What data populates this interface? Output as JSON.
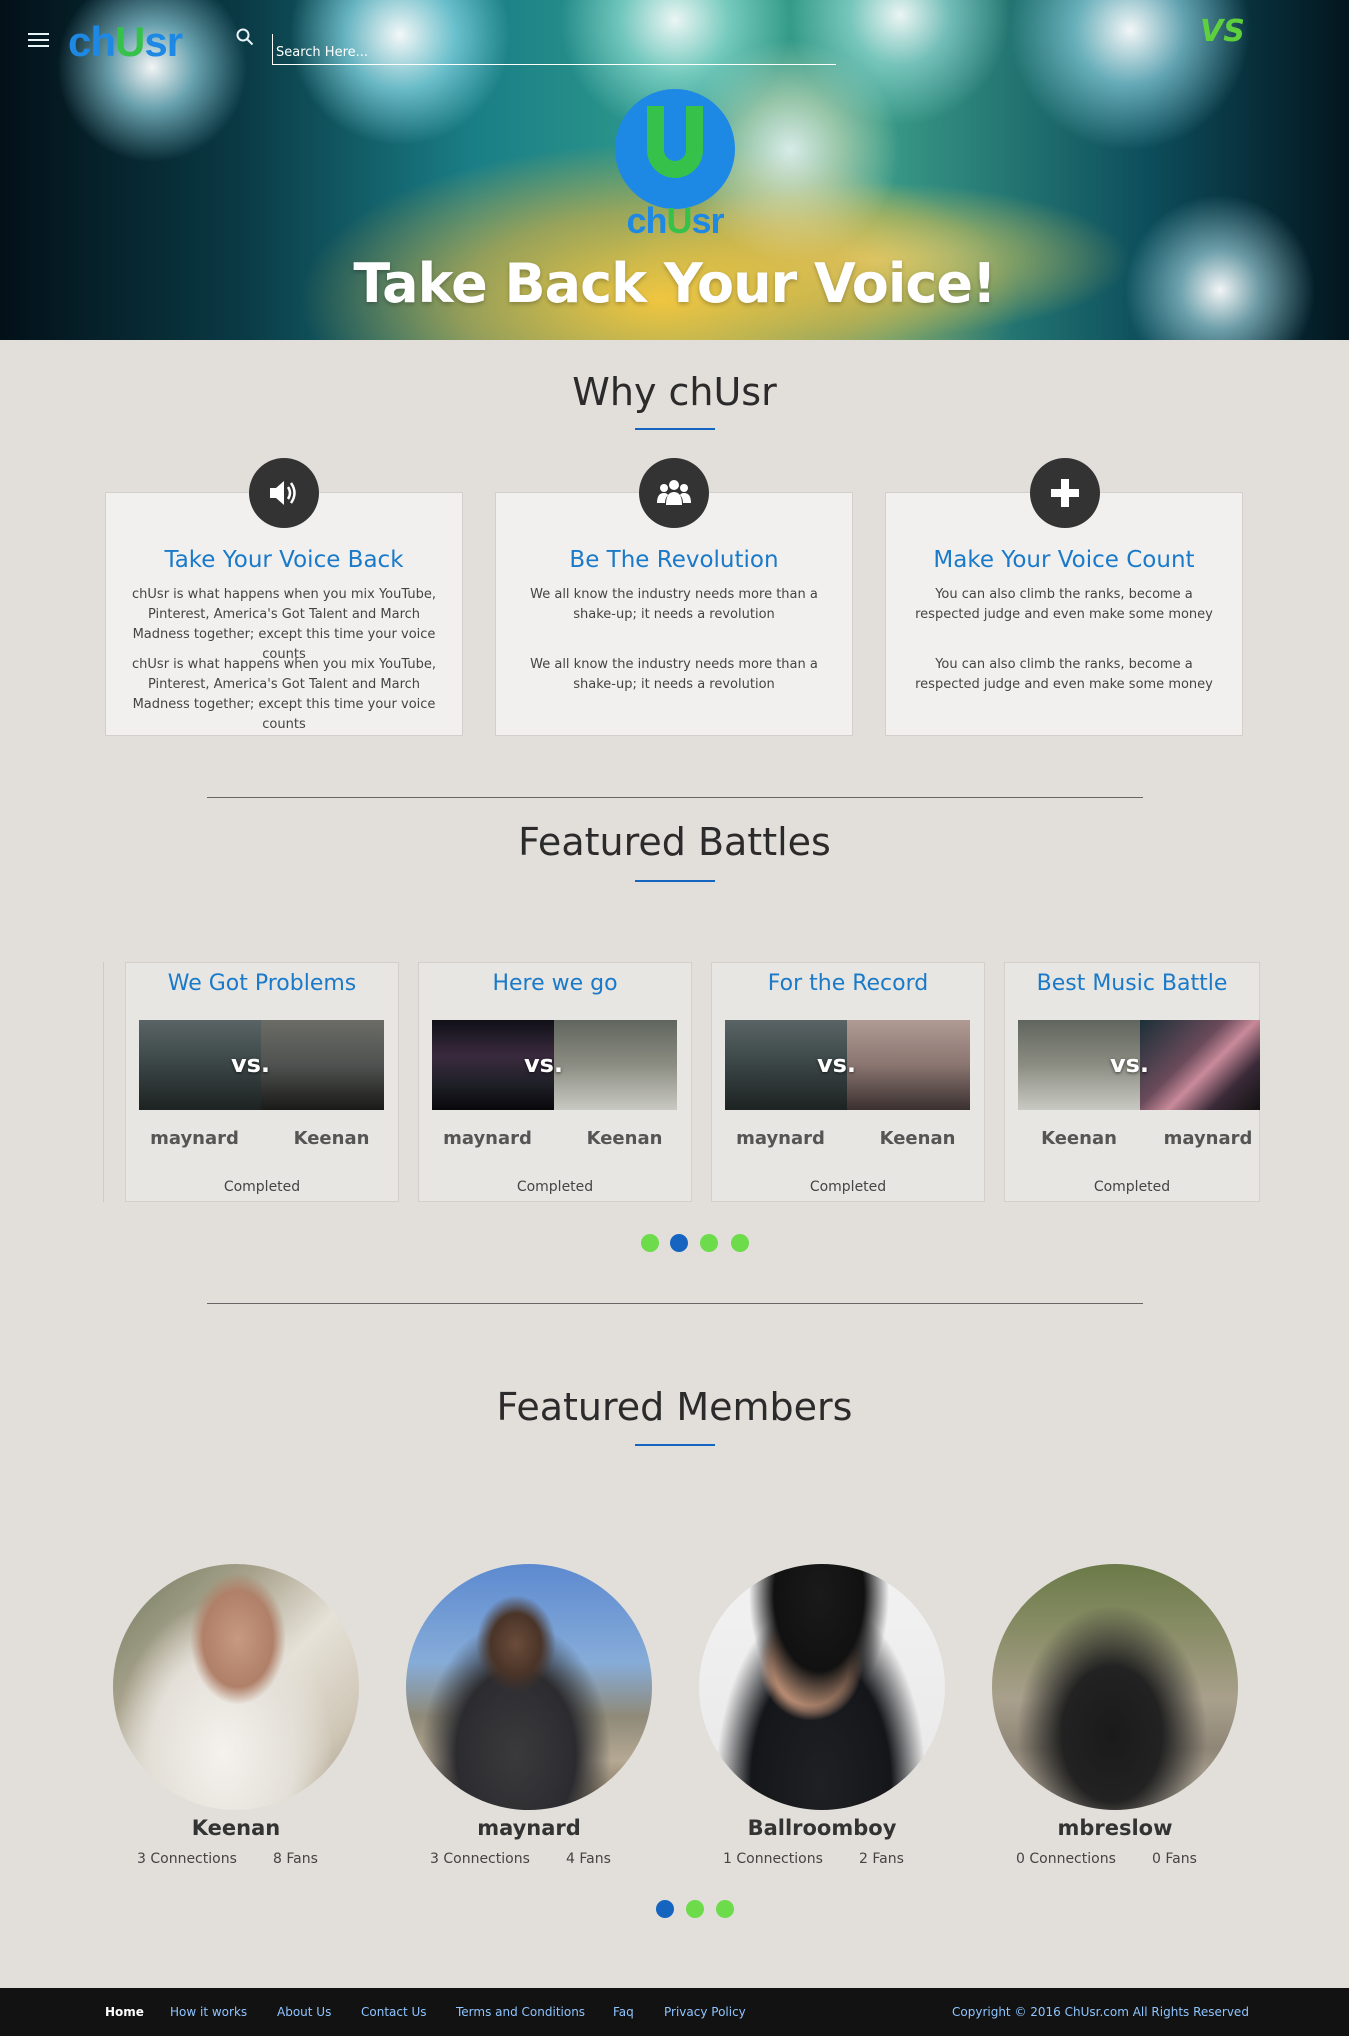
{
  "header": {
    "brand_a": "ch",
    "brand_b": "U",
    "brand_c": "sr",
    "search_placeholder": "Search Here...",
    "vs_logo": "VS"
  },
  "hero": {
    "logo_a": "ch",
    "logo_b": "U",
    "logo_c": "sr",
    "title": "Take Back Your Voice!"
  },
  "why": {
    "title": "Why chUsr",
    "cards": [
      {
        "icon": "speaker-icon",
        "title": "Take Your Voice Back",
        "p1": "chUsr is what happens when you mix YouTube, Pinterest, America's Got Talent and March Madness together; except this time your voice counts",
        "p2": "chUsr is what happens when you mix YouTube, Pinterest, America's Got Talent and March Madness together; except this time your voice counts"
      },
      {
        "icon": "group-icon",
        "title": "Be The Revolution",
        "p1": "We all know the industry needs more than a shake-up; it needs a revolution",
        "p2": "We all know the industry needs more than a shake-up; it needs a revolution"
      },
      {
        "icon": "plus-icon",
        "title": "Make Your Voice Count",
        "p1": "You can also climb the ranks, become a respected judge and even make some money",
        "p2": "You can also climb the ranks, become a respected judge and even make some money"
      }
    ]
  },
  "battles": {
    "title": "Featured Battles",
    "vs_label": "vs.",
    "items": [
      {
        "title": "We Got Problems",
        "left": "maynard",
        "right": "Keenan",
        "status": "Completed"
      },
      {
        "title": "Here we go",
        "left": "maynard",
        "right": "Keenan",
        "status": "Completed"
      },
      {
        "title": "For the Record",
        "left": "maynard",
        "right": "Keenan",
        "status": "Completed"
      },
      {
        "title": "Best Music Battle",
        "left": "Keenan",
        "right": "maynard",
        "status": "Completed"
      }
    ],
    "pager_active_index": 1,
    "pager_count": 4
  },
  "members": {
    "title": "Featured Members",
    "items": [
      {
        "name": "Keenan",
        "connections": "3 Connections",
        "fans": "8 Fans"
      },
      {
        "name": "maynard",
        "connections": "3 Connections",
        "fans": "4 Fans"
      },
      {
        "name": "Ballroomboy",
        "connections": "1 Connections",
        "fans": "2 Fans"
      },
      {
        "name": "mbreslow",
        "connections": "0 Connections",
        "fans": "0 Fans"
      }
    ],
    "pager_active_index": 0,
    "pager_count": 3
  },
  "footer": {
    "links": [
      "Home",
      "How it works",
      "About Us",
      "Contact Us",
      "Terms and Conditions",
      "Faq",
      "Privacy Policy"
    ],
    "copyright": "Copyright © 2016 ChUsr.com All Rights Reserved"
  },
  "colors": {
    "accent_blue": "#1a7ac9",
    "brand_green": "#36c24a",
    "dot_green": "#6cdc4a",
    "dot_blue": "#1565c0"
  }
}
